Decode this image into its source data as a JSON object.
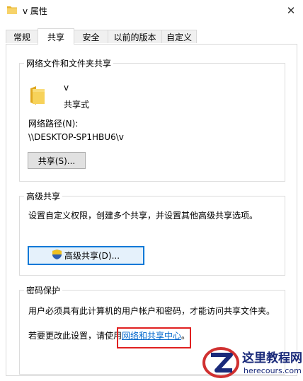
{
  "window": {
    "title": "v 属性",
    "close_glyph": "✕"
  },
  "tabs": [
    {
      "label": "常规",
      "active": false
    },
    {
      "label": "共享",
      "active": true
    },
    {
      "label": "安全",
      "active": false
    },
    {
      "label": "以前的版本",
      "active": false
    },
    {
      "label": "自定义",
      "active": false
    }
  ],
  "network_share": {
    "title": "网络文件和文件夹共享",
    "folder_name": "v",
    "share_state": "共享式",
    "path_label": "网络路径(N):",
    "path_value": "\\\\DESKTOP-SP1HBU6\\v",
    "share_button": "共享(S)..."
  },
  "advanced_share": {
    "title": "高级共享",
    "description": "设置自定义权限，创建多个共享，并设置其他高级共享选项。",
    "button": "高级共享(D)..."
  },
  "password_protection": {
    "title": "密码保护",
    "description": "用户必须具有此计算机的用户帐户和密码，才能访问共享文件夹。",
    "change_prefix": "若要更改此设置，请使用",
    "link_text": "网络和共享中心",
    "change_suffix": "。"
  },
  "watermark": {
    "name": "这里教程网",
    "url": "herecours.com"
  },
  "colors": {
    "accent": "#0078d7",
    "link": "#0066cc",
    "highlight": "#e02020",
    "folder": "#f4c542"
  }
}
